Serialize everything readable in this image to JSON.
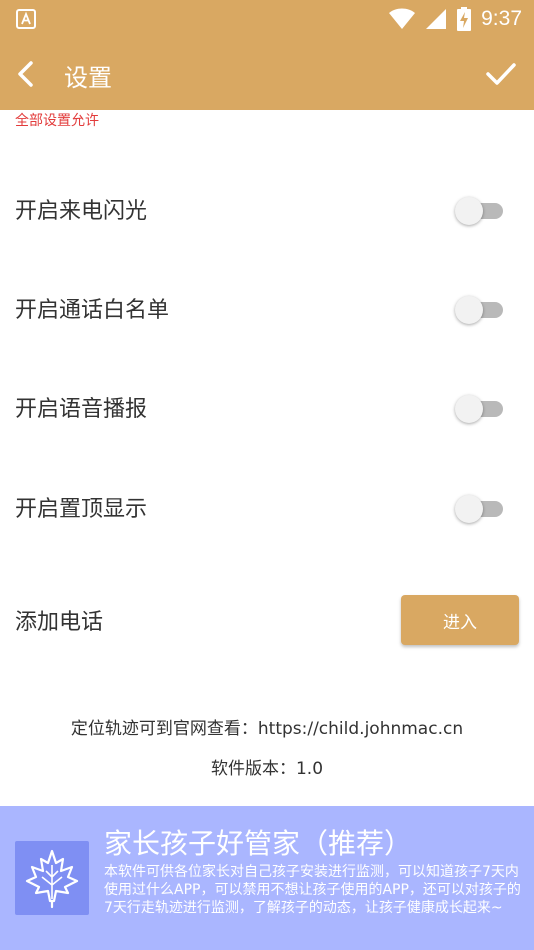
{
  "statusbar": {
    "time": "9:37"
  },
  "appbar": {
    "title": "设置"
  },
  "notice": "全部设置允许",
  "settings": [
    {
      "label": "开启来电闪光",
      "enabled": false
    },
    {
      "label": "开启通话白名单",
      "enabled": false
    },
    {
      "label": "开启语音播报",
      "enabled": false
    },
    {
      "label": "开启置顶显示",
      "enabled": false
    }
  ],
  "add_phone": {
    "label": "添加电话",
    "button_label": "进入"
  },
  "info": {
    "track_text": "定位轨迹可到官网查看：https://child.johnmac.cn",
    "version_text": "软件版本：1.0"
  },
  "banner": {
    "title": "家长孩子好管家（推荐）",
    "description": "本软件可供各位家长对自己孩子安装进行监测，可以知道孩子7天内使用过什么APP，可以禁用不想让孩子使用的APP，还可以对孩子的7天行走轨迹进行监测，了解孩子的动态，让孩子健康成长起来~"
  },
  "colors": {
    "accent": "#d9a862",
    "notice": "#e23b3b",
    "banner_bg": "#aab6ff",
    "banner_logo_bg": "#7f8ff3"
  }
}
